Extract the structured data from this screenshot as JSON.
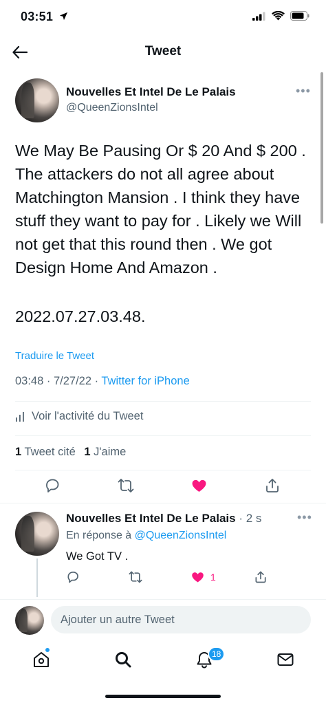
{
  "status_bar": {
    "time": "03:51"
  },
  "header": {
    "title": "Tweet"
  },
  "main_tweet": {
    "display_name": "Nouvelles Et Intel De Le Palais",
    "handle": "@QueenZionsIntel",
    "text": "We May Be Pausing Or $ 20 And $ 200 .  The attackers do not all agree about Matchington Mansion .  I think they have stuff they want to pay for . Likely we Will not get that this round then .  We got Design Home And Amazon .",
    "date_line": "2022.07.27.03.48.",
    "translate_label": "Traduire le Tweet",
    "timestamp": "03:48 · 7/27/22 · ",
    "source": "Twitter for iPhone",
    "activity_label": "Voir l'activité du Tweet",
    "quote_count": "1",
    "quote_label": "Tweet cité",
    "like_count": "1",
    "like_label": "J'aime"
  },
  "reply": {
    "display_name": "Nouvelles Et Intel De Le Palais",
    "time": " · 2 s",
    "reply_prefix": "En réponse à ",
    "reply_mention": "@QueenZionsIntel",
    "text": "We Got TV .",
    "like_count": "1"
  },
  "compose": {
    "placeholder": "Ajouter un autre Tweet"
  },
  "bottom_nav": {
    "notification_count": "18"
  },
  "colors": {
    "accent": "#1d9bf0",
    "like": "#f91880"
  }
}
